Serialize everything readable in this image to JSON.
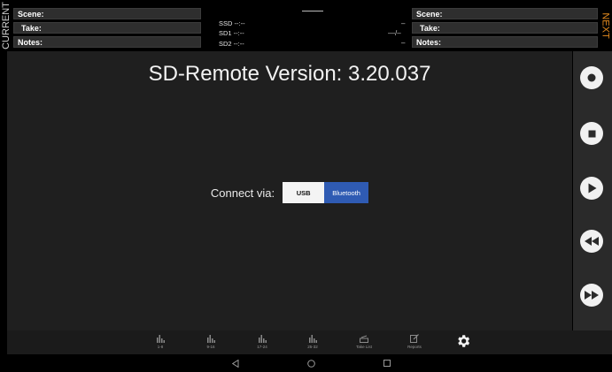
{
  "header": {
    "current_label": "CURRENT",
    "next_label": "NEXT",
    "current": {
      "scene_label": "Scene:",
      "take_label": "Take:",
      "notes_label": "Notes:"
    },
    "next": {
      "scene_label": "Scene:",
      "take_label": "Take:",
      "notes_label": "Notes:"
    },
    "center": {
      "ssd": "SSD --:--",
      "sd1": "SD1 --:--",
      "sd2": "SD2 --:--",
      "right_a": "–",
      "right_b": "—/–",
      "right_c": "–"
    }
  },
  "main": {
    "version_title": "SD-Remote Version: 3.20.037",
    "connect_label": "Connect via:",
    "options": {
      "usb": "USB",
      "bluetooth": "Bluetooth"
    },
    "selected": "Bluetooth"
  },
  "transport": [
    "record-icon",
    "stop-icon",
    "play-icon",
    "rewind-icon",
    "fast-forward-icon"
  ],
  "tabs": {
    "t1": "1-8",
    "t2": "9-16",
    "t3": "17-24",
    "t4": "25-32",
    "t5": "Take List",
    "t6": "Reports",
    "settings_icon": "gear-icon"
  },
  "colors": {
    "accent_blue": "#2f5bb3",
    "next_orange": "#e38a1e",
    "panel_bg": "#1f1f1f"
  }
}
